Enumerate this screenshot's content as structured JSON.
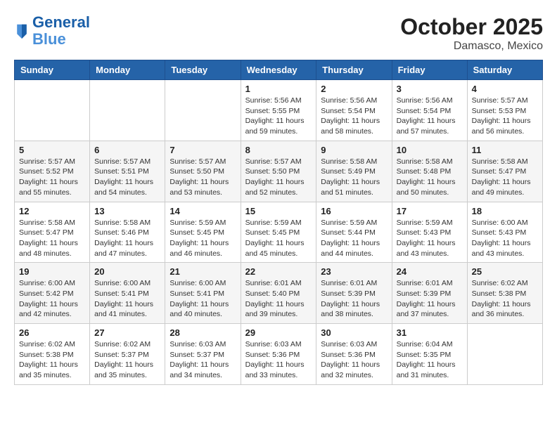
{
  "header": {
    "logo_line1": "General",
    "logo_line2": "Blue",
    "title": "October 2025",
    "subtitle": "Damasco, Mexico"
  },
  "weekdays": [
    "Sunday",
    "Monday",
    "Tuesday",
    "Wednesday",
    "Thursday",
    "Friday",
    "Saturday"
  ],
  "weeks": [
    [
      {
        "day": "",
        "info": ""
      },
      {
        "day": "",
        "info": ""
      },
      {
        "day": "",
        "info": ""
      },
      {
        "day": "1",
        "info": "Sunrise: 5:56 AM\nSunset: 5:55 PM\nDaylight: 11 hours\nand 59 minutes."
      },
      {
        "day": "2",
        "info": "Sunrise: 5:56 AM\nSunset: 5:54 PM\nDaylight: 11 hours\nand 58 minutes."
      },
      {
        "day": "3",
        "info": "Sunrise: 5:56 AM\nSunset: 5:54 PM\nDaylight: 11 hours\nand 57 minutes."
      },
      {
        "day": "4",
        "info": "Sunrise: 5:57 AM\nSunset: 5:53 PM\nDaylight: 11 hours\nand 56 minutes."
      }
    ],
    [
      {
        "day": "5",
        "info": "Sunrise: 5:57 AM\nSunset: 5:52 PM\nDaylight: 11 hours\nand 55 minutes."
      },
      {
        "day": "6",
        "info": "Sunrise: 5:57 AM\nSunset: 5:51 PM\nDaylight: 11 hours\nand 54 minutes."
      },
      {
        "day": "7",
        "info": "Sunrise: 5:57 AM\nSunset: 5:50 PM\nDaylight: 11 hours\nand 53 minutes."
      },
      {
        "day": "8",
        "info": "Sunrise: 5:57 AM\nSunset: 5:50 PM\nDaylight: 11 hours\nand 52 minutes."
      },
      {
        "day": "9",
        "info": "Sunrise: 5:58 AM\nSunset: 5:49 PM\nDaylight: 11 hours\nand 51 minutes."
      },
      {
        "day": "10",
        "info": "Sunrise: 5:58 AM\nSunset: 5:48 PM\nDaylight: 11 hours\nand 50 minutes."
      },
      {
        "day": "11",
        "info": "Sunrise: 5:58 AM\nSunset: 5:47 PM\nDaylight: 11 hours\nand 49 minutes."
      }
    ],
    [
      {
        "day": "12",
        "info": "Sunrise: 5:58 AM\nSunset: 5:47 PM\nDaylight: 11 hours\nand 48 minutes."
      },
      {
        "day": "13",
        "info": "Sunrise: 5:58 AM\nSunset: 5:46 PM\nDaylight: 11 hours\nand 47 minutes."
      },
      {
        "day": "14",
        "info": "Sunrise: 5:59 AM\nSunset: 5:45 PM\nDaylight: 11 hours\nand 46 minutes."
      },
      {
        "day": "15",
        "info": "Sunrise: 5:59 AM\nSunset: 5:45 PM\nDaylight: 11 hours\nand 45 minutes."
      },
      {
        "day": "16",
        "info": "Sunrise: 5:59 AM\nSunset: 5:44 PM\nDaylight: 11 hours\nand 44 minutes."
      },
      {
        "day": "17",
        "info": "Sunrise: 5:59 AM\nSunset: 5:43 PM\nDaylight: 11 hours\nand 43 minutes."
      },
      {
        "day": "18",
        "info": "Sunrise: 6:00 AM\nSunset: 5:43 PM\nDaylight: 11 hours\nand 43 minutes."
      }
    ],
    [
      {
        "day": "19",
        "info": "Sunrise: 6:00 AM\nSunset: 5:42 PM\nDaylight: 11 hours\nand 42 minutes."
      },
      {
        "day": "20",
        "info": "Sunrise: 6:00 AM\nSunset: 5:41 PM\nDaylight: 11 hours\nand 41 minutes."
      },
      {
        "day": "21",
        "info": "Sunrise: 6:00 AM\nSunset: 5:41 PM\nDaylight: 11 hours\nand 40 minutes."
      },
      {
        "day": "22",
        "info": "Sunrise: 6:01 AM\nSunset: 5:40 PM\nDaylight: 11 hours\nand 39 minutes."
      },
      {
        "day": "23",
        "info": "Sunrise: 6:01 AM\nSunset: 5:39 PM\nDaylight: 11 hours\nand 38 minutes."
      },
      {
        "day": "24",
        "info": "Sunrise: 6:01 AM\nSunset: 5:39 PM\nDaylight: 11 hours\nand 37 minutes."
      },
      {
        "day": "25",
        "info": "Sunrise: 6:02 AM\nSunset: 5:38 PM\nDaylight: 11 hours\nand 36 minutes."
      }
    ],
    [
      {
        "day": "26",
        "info": "Sunrise: 6:02 AM\nSunset: 5:38 PM\nDaylight: 11 hours\nand 35 minutes."
      },
      {
        "day": "27",
        "info": "Sunrise: 6:02 AM\nSunset: 5:37 PM\nDaylight: 11 hours\nand 35 minutes."
      },
      {
        "day": "28",
        "info": "Sunrise: 6:03 AM\nSunset: 5:37 PM\nDaylight: 11 hours\nand 34 minutes."
      },
      {
        "day": "29",
        "info": "Sunrise: 6:03 AM\nSunset: 5:36 PM\nDaylight: 11 hours\nand 33 minutes."
      },
      {
        "day": "30",
        "info": "Sunrise: 6:03 AM\nSunset: 5:36 PM\nDaylight: 11 hours\nand 32 minutes."
      },
      {
        "day": "31",
        "info": "Sunrise: 6:04 AM\nSunset: 5:35 PM\nDaylight: 11 hours\nand 31 minutes."
      },
      {
        "day": "",
        "info": ""
      }
    ]
  ]
}
